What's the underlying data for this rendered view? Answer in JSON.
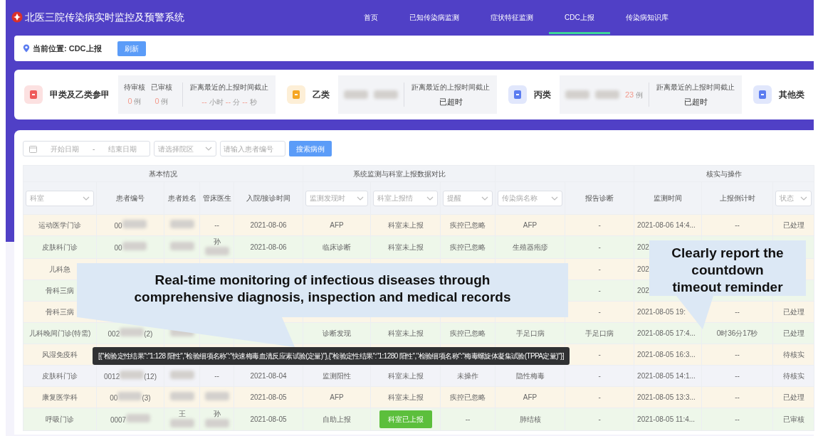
{
  "app": {
    "title": "北医三院传染病实时监控及预警系统"
  },
  "nav": [
    {
      "label": "首页",
      "selected": false
    },
    {
      "label": "已知传染病监测",
      "selected": false
    },
    {
      "label": "症状特征监测",
      "selected": false
    },
    {
      "label": "CDC上报",
      "selected": true
    },
    {
      "label": "传染病知识库",
      "selected": false
    }
  ],
  "breadcrumb": {
    "label": "当前位置: CDC上报",
    "button": "刷新"
  },
  "categories": [
    {
      "name": "甲类及乙类参甲",
      "color": "#ef5b5b",
      "stats": [
        {
          "label": "待审核",
          "value": "0",
          "unit": "例"
        },
        {
          "label": "已审核",
          "value": "0",
          "unit": "例"
        }
      ],
      "deadline_label": "距离最近的上报时间截止",
      "deadline": {
        "kind": "timer",
        "parts": [
          {
            "value": "--",
            "unit": "小时"
          },
          {
            "value": "--",
            "unit": "分"
          },
          {
            "value": "--",
            "unit": "秒"
          }
        ]
      }
    },
    {
      "name": "乙类",
      "color": "#f5a623",
      "redacted": true,
      "deadline_label": "距离最近的上报时间截止",
      "deadline": {
        "kind": "text",
        "text": "已超时"
      }
    },
    {
      "name": "丙类",
      "color": "#5b7cf0",
      "redacted": true,
      "stats": [
        {
          "value": "23",
          "unit": "例"
        }
      ],
      "deadline_label": "距离最近的上报时间截止",
      "deadline": {
        "kind": "text",
        "text": "已超时"
      }
    },
    {
      "name": "其他类",
      "color": "#5b7cf0"
    }
  ],
  "filters": {
    "start_placeholder": "开始日期",
    "separator": "-",
    "end_placeholder": "结束日期",
    "campus_placeholder": "请选择院区",
    "patient_placeholder": "请输入患者编号",
    "search_button": "搜索病例"
  },
  "table": {
    "groups": [
      {
        "label": "基本情况"
      },
      {
        "label": "系统监测与科室上报数据对比"
      },
      {
        "label": "核实与操作"
      }
    ],
    "columns": [
      {
        "label": "科室",
        "kind": "select"
      },
      {
        "label": "患者编号",
        "kind": "text"
      },
      {
        "label": "患者姓名",
        "kind": "text"
      },
      {
        "label": "管床医生",
        "kind": "text"
      },
      {
        "label": "入院/接诊时间",
        "kind": "text"
      },
      {
        "label": "监测发现时",
        "kind": "select"
      },
      {
        "label": "科室上报情",
        "kind": "select"
      },
      {
        "label": "提醒",
        "kind": "select"
      },
      {
        "label": "传染病名称",
        "kind": "select"
      },
      {
        "label": "报告诊断",
        "kind": "text"
      },
      {
        "label": "监测时间",
        "kind": "text"
      },
      {
        "label": "上报倒计时",
        "kind": "text"
      },
      {
        "label": "状态",
        "kind": "select"
      }
    ],
    "rows": [
      {
        "color": "#fbf5e7",
        "cells": [
          {
            "text": "运动医学门诊"
          },
          {
            "text": "00",
            "redacted": true
          },
          {
            "redacted": true
          },
          {
            "text": "--"
          },
          {
            "text": "2021-08-06"
          },
          {
            "text": "AFP"
          },
          {
            "text": "科室未上报"
          },
          {
            "text": "疾控已忽略"
          },
          {
            "text": "AFP"
          },
          {
            "text": "-"
          },
          {
            "text": "2021-08-06 14:4..."
          },
          {
            "text": "--"
          },
          {
            "text": "已处理"
          }
        ]
      },
      {
        "color": "#eef7ea",
        "cells": [
          {
            "text": "皮肤科门诊"
          },
          {
            "text": "00",
            "redacted": true
          },
          {
            "redacted": true
          },
          {
            "text": "孙",
            "redacted": true
          },
          {
            "text": "2021-08-06"
          },
          {
            "text": "临床诊断"
          },
          {
            "text": "科室未上报"
          },
          {
            "text": "疾控已忽略"
          },
          {
            "text": "生殖器疱疹"
          },
          {
            "text": "-"
          },
          {
            "text": "202"
          },
          null,
          null
        ]
      },
      {
        "color": "#fbf5e7",
        "cells": [
          {
            "text": "儿科急"
          },
          null,
          null,
          null,
          null,
          null,
          null,
          null,
          null,
          {
            "text": "-"
          },
          {
            "text": "202"
          },
          null,
          null
        ]
      },
      {
        "color": "#eef7ea",
        "cells": [
          {
            "text": "骨科三病"
          },
          null,
          null,
          null,
          null,
          null,
          null,
          null,
          null,
          {
            "text": "-"
          },
          {
            "text": "202"
          },
          null,
          null
        ]
      },
      {
        "color": "#fbf5e7",
        "cells": [
          {
            "text": "骨科三病"
          },
          null,
          null,
          null,
          null,
          null,
          null,
          null,
          null,
          {
            "text": "-"
          },
          {
            "text": "2021-08-05 19:"
          },
          {
            "text": "--"
          },
          {
            "text": "已处理"
          }
        ]
      },
      {
        "color": "#eef7ea",
        "cells": [
          {
            "text": "儿科晚间门诊(特需)"
          },
          {
            "text": "002",
            "redacted": true,
            "suffix": "(2)"
          },
          {
            "redacted": true
          },
          null,
          null,
          {
            "text": "诊断发现"
          },
          {
            "text": "科室未上报"
          },
          {
            "text": "疾控已忽略"
          },
          {
            "text": "手足口病"
          },
          {
            "text": "手足口病"
          },
          {
            "text": "2021-08-05 17:4..."
          },
          {
            "text": "0时36分17秒"
          },
          {
            "text": "已处理"
          }
        ]
      },
      {
        "color": "#fbf5e7",
        "cells": [
          {
            "text": "风湿免疫科"
          },
          null,
          null,
          null,
          null,
          null,
          null,
          null,
          null,
          {
            "text": "-"
          },
          {
            "text": "2021-08-05 16:3..."
          },
          {
            "text": "--"
          },
          {
            "text": "待核实"
          }
        ]
      },
      {
        "color": "#f2f3f8",
        "cells": [
          {
            "text": "皮肤科门诊"
          },
          {
            "text": "0012",
            "redacted": true,
            "suffix": "(12)"
          },
          {
            "redacted": true
          },
          {
            "text": "--"
          },
          {
            "text": "2021-08-04"
          },
          {
            "text": "监测阳性"
          },
          {
            "text": "科室未上报"
          },
          {
            "text": "未操作"
          },
          {
            "text": "隐性梅毒"
          },
          {
            "text": "-"
          },
          {
            "text": "2021-08-05 14:1..."
          },
          {
            "text": "--"
          },
          {
            "text": "待核实"
          }
        ]
      },
      {
        "color": "#fbf5e7",
        "cells": [
          {
            "text": "康复医学科"
          },
          {
            "text": "00",
            "redacted": true,
            "suffix": "(3)"
          },
          {
            "redacted": true
          },
          {
            "redacted": true
          },
          {
            "text": "2021-08-05"
          },
          {
            "text": "AFP"
          },
          {
            "text": "科室未上报"
          },
          {
            "text": "疾控已忽略"
          },
          {
            "text": "AFP"
          },
          {
            "text": "-"
          },
          {
            "text": "2021-08-05 13:3..."
          },
          {
            "text": "--"
          },
          {
            "text": "已处理"
          }
        ]
      },
      {
        "color": "#eef7ea",
        "cells": [
          {
            "text": "呼吸门诊"
          },
          {
            "text": "0007",
            "redacted": true
          },
          {
            "text": "王",
            "redacted": true
          },
          {
            "text": "孙",
            "redacted": true
          },
          {
            "text": "2021-08-05"
          },
          {
            "text": "自助上报"
          },
          {
            "text": "科室已上报",
            "kind": "button"
          },
          {
            "text": "--"
          },
          {
            "text": "肺结核"
          },
          {
            "text": "-"
          },
          {
            "text": "2021-08-05 11:4..."
          },
          {
            "text": "--"
          },
          {
            "text": "已审核"
          }
        ]
      }
    ]
  },
  "tooltip": {
    "text": "[{\"检验定性结果\":\"1:128 阳性\",\"检验细项名称\":\"快速梅毒血清反应素试验(定量)\"},{\"检验定性结果\":\"1:1280 阳性\",\"检验细项名称\":\"梅毒螺旋体凝集试验(TPPA定量)\"}]"
  },
  "annotations": [
    {
      "text": "Real-time monitoring of infectious diseases through comprehensive diagnosis, inspection and medical records"
    },
    {
      "text": "Clearly report the countdown timeout reminder"
    }
  ]
}
